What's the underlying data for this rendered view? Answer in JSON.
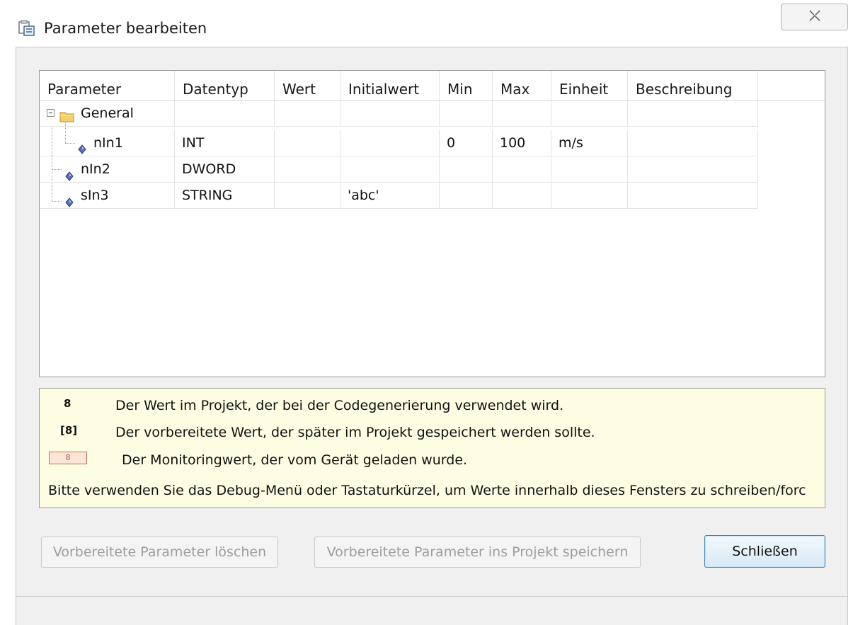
{
  "window": {
    "title": "Parameter bearbeiten",
    "close_glyph": "✕"
  },
  "table": {
    "columns": [
      "Parameter",
      "Datentyp",
      "Wert",
      "Initialwert",
      "Min",
      "Max",
      "Einheit",
      "Beschreibung"
    ],
    "rows": [
      {
        "parameter": "General",
        "datentyp": "",
        "wert": "",
        "initialwert": "",
        "min": "",
        "max": "",
        "einheit": "",
        "beschreibung": "",
        "icon": "folder-icon",
        "expander": "⊟"
      },
      {
        "parameter": "nIn1",
        "datentyp": "INT",
        "wert": "",
        "initialwert": "",
        "min": "0",
        "max": "100",
        "einheit": "m/s",
        "beschreibung": "",
        "icon": "parameter-icon"
      },
      {
        "parameter": "nIn2",
        "datentyp": "DWORD",
        "wert": "",
        "initialwert": "",
        "min": "",
        "max": "",
        "einheit": "",
        "beschreibung": "",
        "icon": "parameter-icon"
      },
      {
        "parameter": "sIn3",
        "datentyp": "STRING",
        "wert": "",
        "initialwert": "'abc'",
        "min": "",
        "max": "",
        "einheit": "",
        "beschreibung": "",
        "icon": "parameter-icon"
      }
    ]
  },
  "legend": {
    "items": [
      {
        "symbol": "8",
        "text": "Der Wert im Projekt, der bei der Codegenerierung verwendet wird."
      },
      {
        "symbol": "[8]",
        "text": "Der vorbereitete Wert, der später im Projekt gespeichert werden sollte."
      },
      {
        "symbol": "8",
        "text": "Der Monitoringwert, der vom Gerät geladen wurde."
      }
    ],
    "note": "Bitte verwenden Sie das Debug-Menü oder Tastaturkürzel, um Werte innerhalb dieses Fensters zu schreiben/forc"
  },
  "buttons": {
    "delete_prepared": "Vorbereitete Parameter löschen",
    "save_prepared": "Vorbereitete Parameter ins Projekt speichern",
    "close": "Schließen"
  },
  "colors": {
    "legend_bg": "#fdfde3",
    "monitor_bg": "#fce4d6",
    "primary_border": "#3c7fb1"
  }
}
